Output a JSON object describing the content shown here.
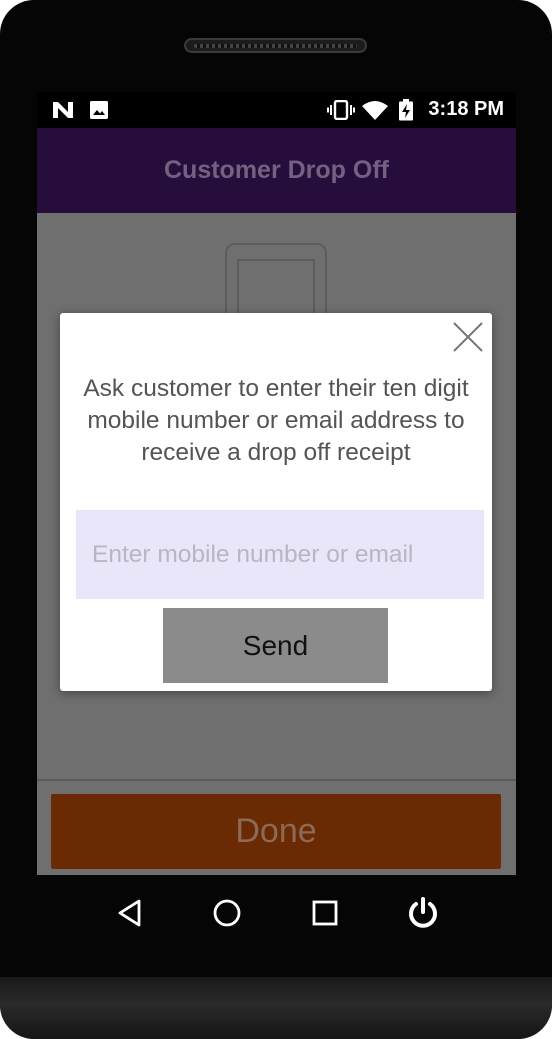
{
  "statusbar": {
    "icons": [
      "n-notification-icon",
      "image-notification-icon",
      "vibrate-icon",
      "wifi-icon",
      "battery-charging-icon"
    ],
    "time": "3:18 PM"
  },
  "appbar": {
    "title": "Customer Drop Off"
  },
  "dialog": {
    "message": "Ask customer to enter their ten digit mobile number or email address to receive a drop off receipt",
    "input_value": "",
    "input_placeholder": "Enter mobile number or email",
    "send_label": "Send",
    "close_icon": "close-icon"
  },
  "footer": {
    "done_label": "Done"
  },
  "navbar": {
    "icons": [
      "back-icon",
      "home-icon",
      "recents-icon",
      "power-icon"
    ]
  },
  "colors": {
    "appbar": "#260d3b",
    "appbar_title": "#736181",
    "overlay": "#6f6f6f",
    "done_button": "#6a2a03",
    "input_bg": "#e8e6f8",
    "send_button": "#8b8b8b"
  }
}
